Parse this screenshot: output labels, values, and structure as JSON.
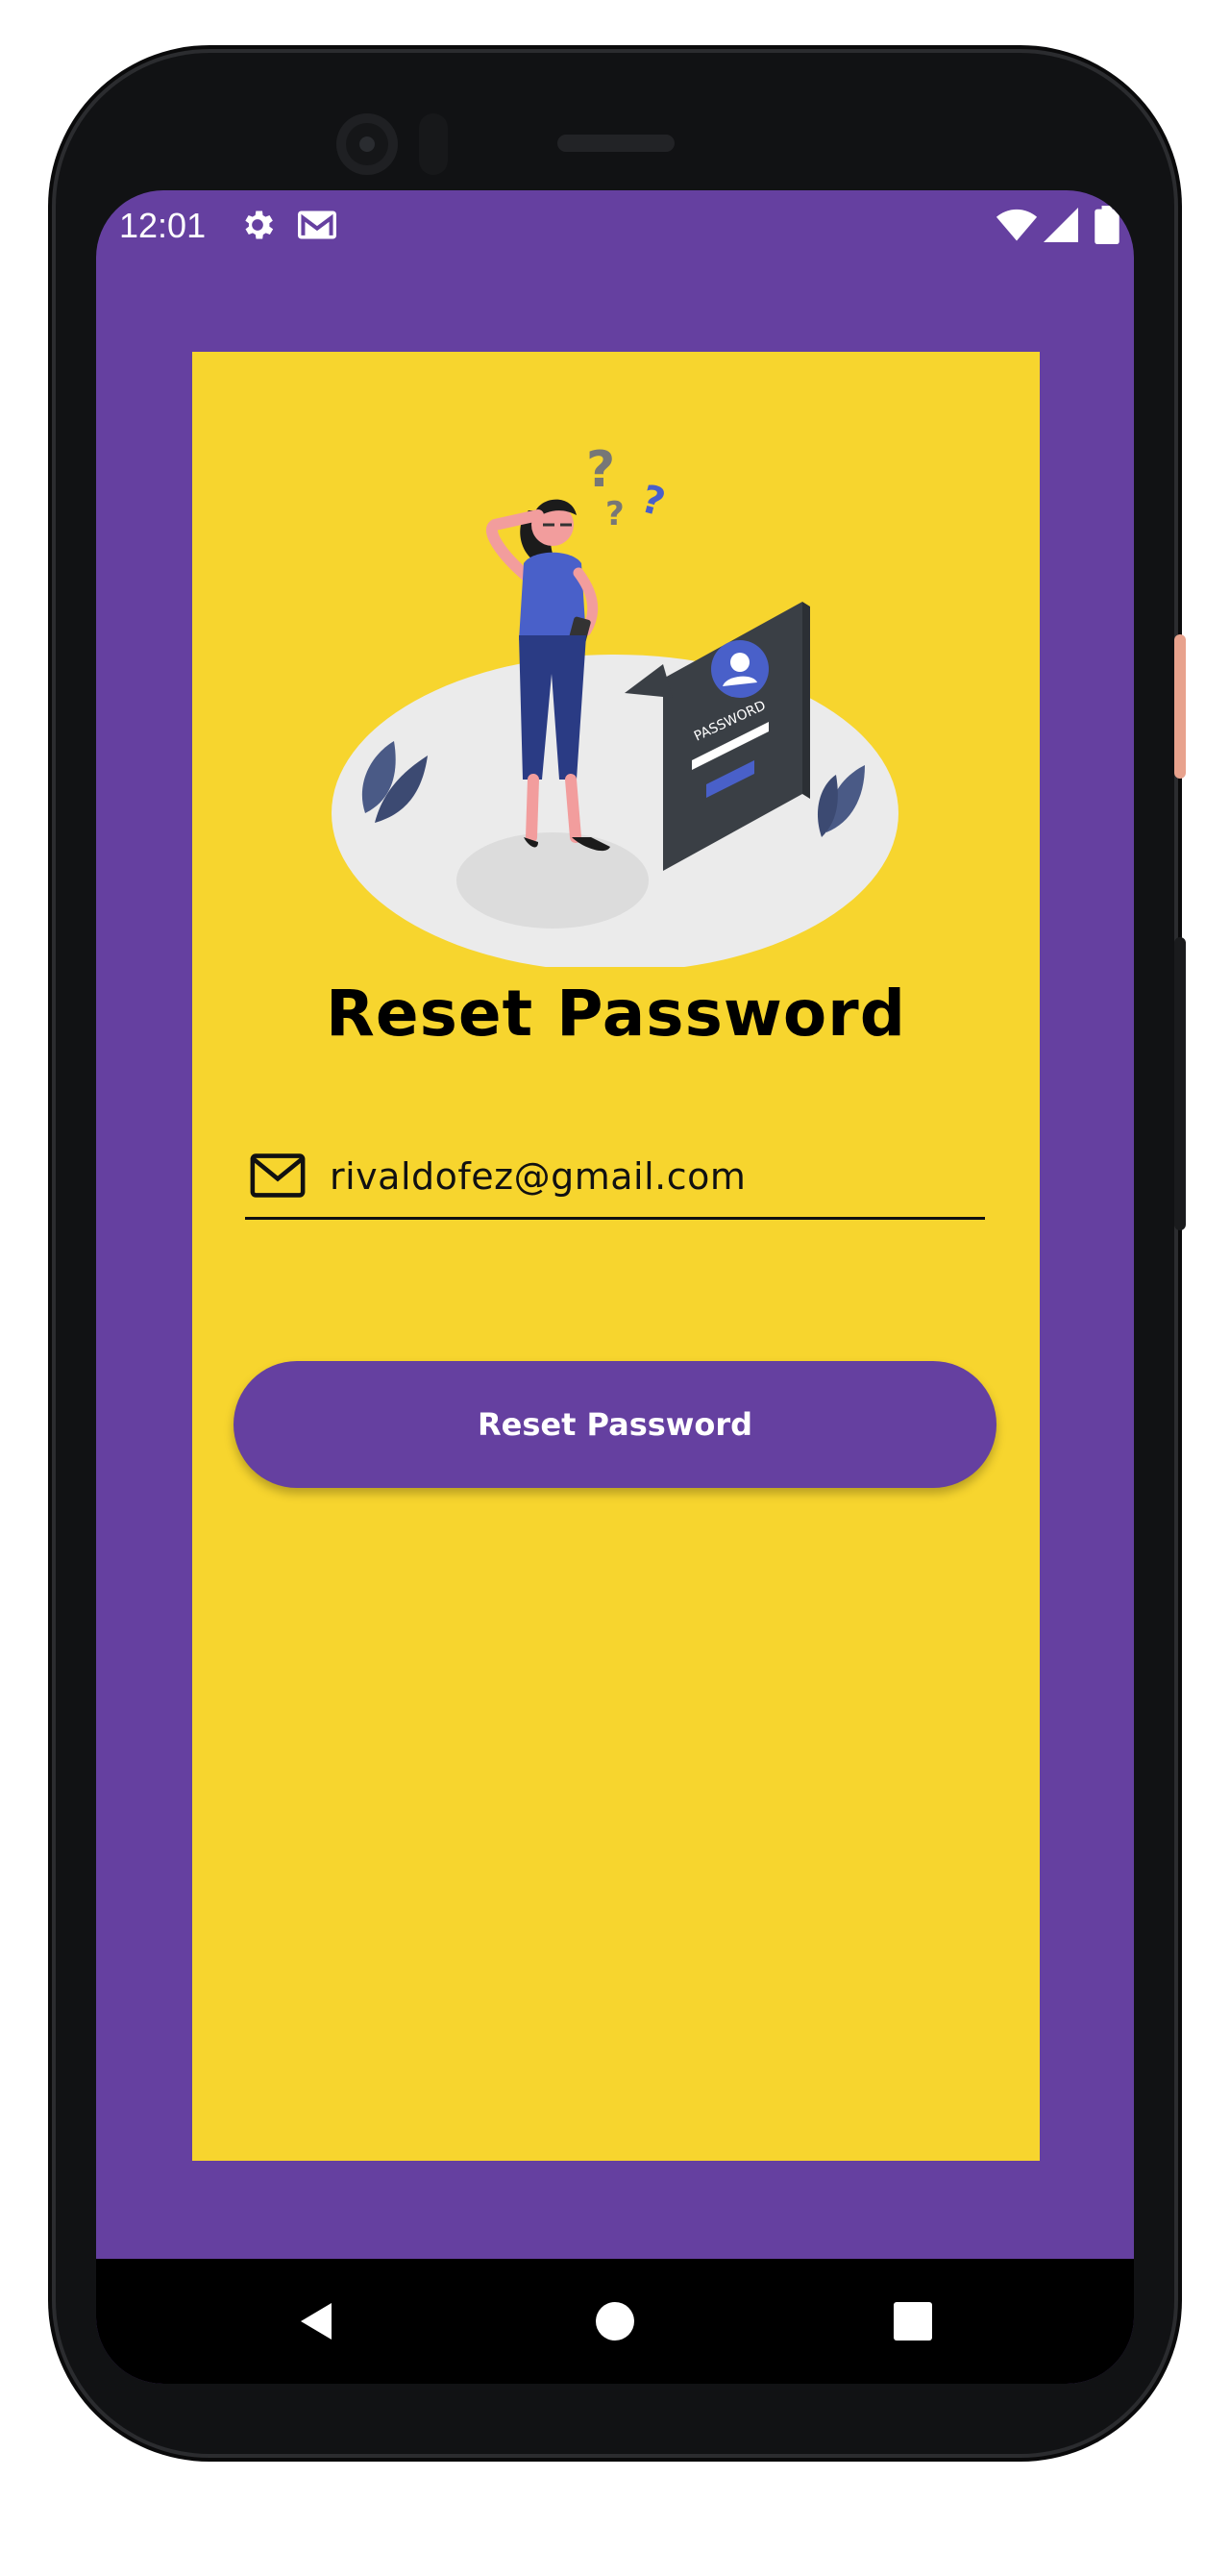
{
  "status_bar": {
    "time": "12:01",
    "left_icons": [
      "gear-icon",
      "gmail-icon"
    ],
    "right_icons": [
      "wifi-icon",
      "signal-icon",
      "battery-icon"
    ]
  },
  "reset_form": {
    "title": "Reset Password",
    "email_value": "rivaldofez@gmail.com",
    "button_label": "Reset Password",
    "illustration_text": "PASSWORD"
  },
  "nav_bar": {
    "buttons": [
      "back-icon",
      "home-icon",
      "recents-icon"
    ]
  },
  "colors": {
    "primary": "#6540a0",
    "card": "#f7d52e",
    "text": "#000000"
  }
}
